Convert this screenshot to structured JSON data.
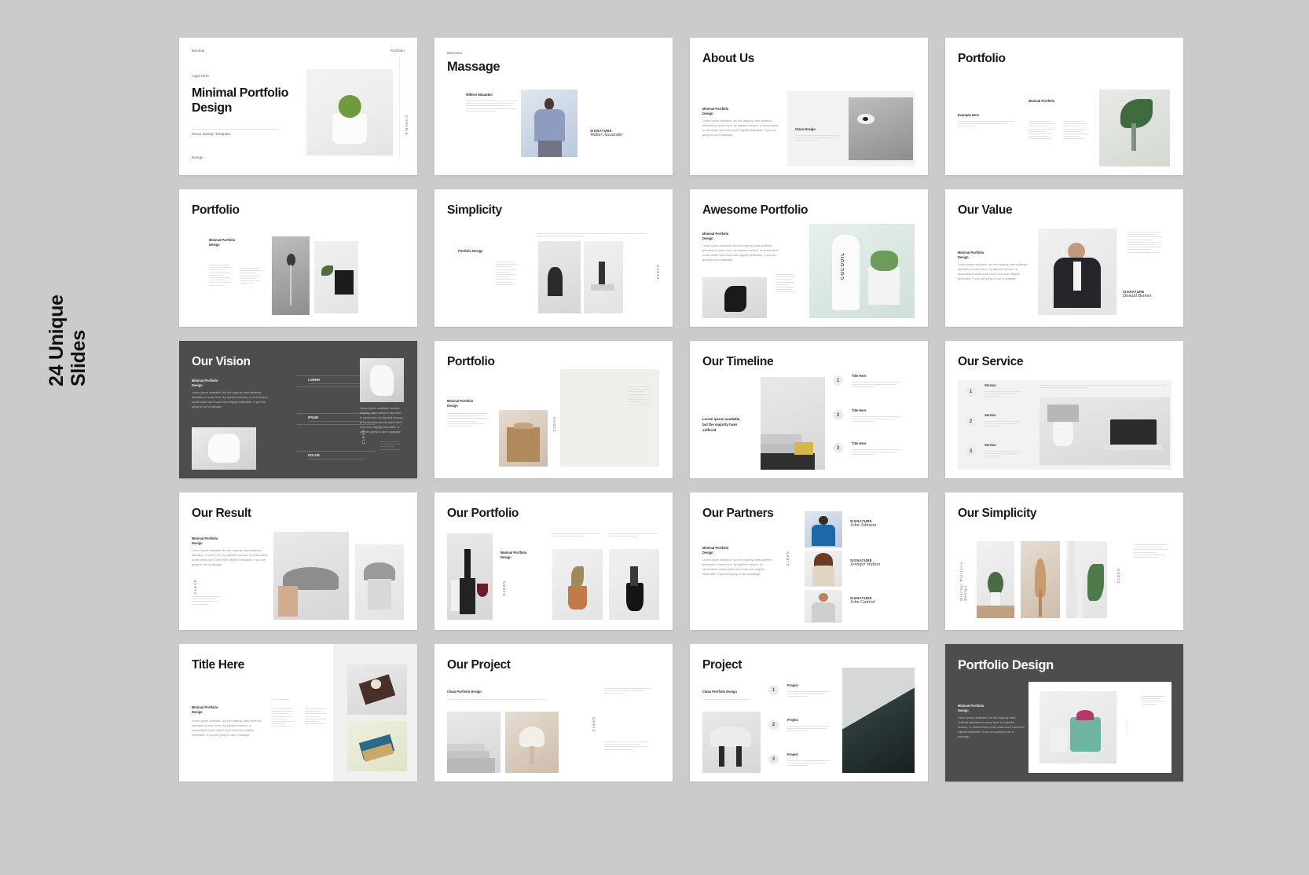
{
  "page": {
    "background_color": "#cbcbcb",
    "side_label": "24 Unique\nSlides",
    "accent_dark": "#4d4d4d",
    "slide_bg": "#ffffff"
  },
  "common": {
    "subtitle": "Minimal Portfolio\nDesign",
    "body": "Lorem ipsum available, but the majority have suffered alteration in some form, by injected humour, or randomised words which don't look even slightly believable. If you are going to use a passage.",
    "clean_vertical": "CLEAN",
    "signature_label": "SIGNATURE"
  },
  "slides": [
    {
      "id": 1,
      "title": "Minimal Portfolio\nDesign",
      "header_left": "Minimal",
      "header_right": "Portfolio",
      "logo": "Logo Here",
      "caption": "Clean Design Template",
      "footer": "Design",
      "vertical": "Presents",
      "dark": false,
      "image": "cactus-in-white-pot"
    },
    {
      "id": 2,
      "eyebrow": "Welcome",
      "title": "Massage",
      "person_name": "Wilkins Micawber",
      "signature_label": "SIGNATURE",
      "signature_name": "Walter Alexander",
      "dark": false,
      "image": "man-with-phone"
    },
    {
      "id": 3,
      "title": "About Us",
      "subtitle": "Minimal Portfolio\nDesign",
      "panel_label": "Clean Design",
      "dark": false,
      "image": "close-up-face-bw"
    },
    {
      "id": 4,
      "title": "Portfolio",
      "label_left": "Example Here",
      "label_right": "Minimal Portfolio",
      "dark": false,
      "image": "green-leaf-in-vase"
    },
    {
      "id": 5,
      "title": "Portfolio",
      "subtitle": "Minimal Portfolio\nDesign",
      "dark": false,
      "image": "flower-bw-and-laptop"
    },
    {
      "id": 6,
      "title": "Simplicity",
      "label": "Portfolio Design",
      "vertical": "CLEAN",
      "dark": false,
      "image": "wishbone-chair-and-statue"
    },
    {
      "id": 7,
      "title": "Awesome Portfolio",
      "subtitle": "Minimal Portfolio\nDesign",
      "dark": false,
      "image": "cocooil-bottle-and-plant",
      "product_label": "COCOOIL"
    },
    {
      "id": 8,
      "title": "Our Value",
      "subtitle": "Minimal Portfolio\nDesign",
      "signature_label": "SIGNATURE",
      "signature_name": "Donald Bennet",
      "dark": false,
      "image": "man-in-suit"
    },
    {
      "id": 9,
      "title": "Our Vision",
      "subtitle": "Minimal Portfolio\nDesign",
      "list": [
        "LOREM",
        "IPSUM",
        "DOLOR"
      ],
      "vertical": "CLEAN",
      "dark": true,
      "image": "white-fabric-fashion"
    },
    {
      "id": 10,
      "title": "Portfolio",
      "subtitle": "Minimal Portfolio\nDesign",
      "vertical": "CLEAN",
      "dark": false,
      "image": "paper-bags"
    },
    {
      "id": 11,
      "title": "Our Timeline",
      "note": "Lorem ipsum available, but the majority have suffered",
      "steps": [
        {
          "num": "1",
          "label": "Title Here"
        },
        {
          "num": "2",
          "label": "Title Here"
        },
        {
          "num": "3",
          "label": "Title Here"
        }
      ],
      "dark": false,
      "image": "staircase-interior"
    },
    {
      "id": 12,
      "title": "Our Service",
      "steps": [
        {
          "num": "1",
          "label": "Service"
        },
        {
          "num": "2",
          "label": "Service"
        },
        {
          "num": "3",
          "label": "Service"
        }
      ],
      "dark": false,
      "image": "vase-and-laptop-desk"
    },
    {
      "id": 13,
      "title": "Our Result",
      "subtitle": "Minimal Portfolio\nDesign",
      "vertical": "CLEAN",
      "dark": false,
      "image": "woman-with-hat"
    },
    {
      "id": 14,
      "title": "Our Portfolio",
      "subtitle": "Minimal Portfolio\nDesign",
      "vertical": "CLEAN",
      "dark": false,
      "image": "wine-bottle-and-vases"
    },
    {
      "id": 15,
      "title": "Our Partners",
      "subtitle": "Minimal Portfolio\nDesign",
      "vertical": "CLEAN",
      "partners": [
        {
          "signature_label": "SIGNATURE",
          "signature_name": "John Johnson"
        },
        {
          "signature_label": "SIGNATURE",
          "signature_name": "Jennifer Walton"
        },
        {
          "signature_label": "SIGNATURE",
          "signature_name": "John Gabriel"
        }
      ],
      "dark": false,
      "image": "three-portraits"
    },
    {
      "id": 16,
      "title": "Our Simplicity",
      "vertical_left": "Minimal Portfolio\nDesign",
      "vertical_right": "CLEAN",
      "dark": false,
      "image": "three-plant-photos"
    },
    {
      "id": 17,
      "title": "Title Here",
      "subtitle": "Minimal Portfolio\nDesign",
      "dark": false,
      "image": "notebook-and-books"
    },
    {
      "id": 18,
      "title": "Our Project",
      "label": "Clean Portfolio Design",
      "vertical": "CLEAN",
      "dark": false,
      "image": "stairs-and-chair"
    },
    {
      "id": 19,
      "title": "Project",
      "label": "Clean Portfolio Design",
      "steps": [
        {
          "num": "1",
          "label": "Project"
        },
        {
          "num": "2",
          "label": "Project"
        },
        {
          "num": "3",
          "label": "Project"
        }
      ],
      "dark": false,
      "image": "modern-building"
    },
    {
      "id": 20,
      "title": "Portfolio Design",
      "subtitle": "Minimal Portfolio\nDesign",
      "vertical": "CLEAN",
      "dark": true,
      "image": "candle-product"
    }
  ]
}
